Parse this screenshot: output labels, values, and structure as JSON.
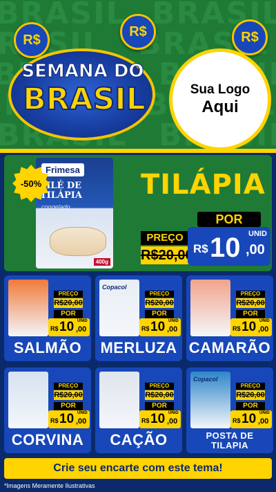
{
  "header": {
    "bg_word": "BRASIL",
    "coin_symbol": "R$",
    "title_line1": "SEMANA DO",
    "title_line2": "BRASIL",
    "logo_line1": "Sua Logo",
    "logo_line2": "Aqui"
  },
  "hero": {
    "discount": "-50%",
    "pack_brand": "Frimesa",
    "pack_name": "FILÉ DE TILÁPIA",
    "pack_sub": "congelado",
    "pack_weight": "400g",
    "title": "TILÁPIA",
    "preco_label": "PREÇO",
    "old_price": "R$20,00",
    "por_label": "POR",
    "price_currency": "R$",
    "price_int": "10",
    "price_dec": ",00",
    "unit": "UNID"
  },
  "common": {
    "preco_label": "PREÇO",
    "old_price": "R$20,00",
    "por_label": "POR",
    "currency": "R$",
    "price_int": "10",
    "price_dec": ",00",
    "unit": "UNID"
  },
  "products": [
    {
      "name": "SALMÃO",
      "pack_color": "#f07a3a"
    },
    {
      "name": "MERLUZA",
      "pack_color": "#e8eef6",
      "brand": "Copacol"
    },
    {
      "name": "CAMARÃO",
      "pack_color": "#f2a38a"
    },
    {
      "name": "CORVINA",
      "pack_color": "#d7e2f1"
    },
    {
      "name": "CAÇÃO",
      "pack_color": "#dfe5ee"
    },
    {
      "name": "POSTA DE TILAPIA",
      "pack_color": "#2f86c9",
      "brand": "Copacol"
    }
  ],
  "footer": {
    "cta": "Crie seu encarte com este tema!",
    "note": "*Imagens Meramente Ilustrativas"
  }
}
